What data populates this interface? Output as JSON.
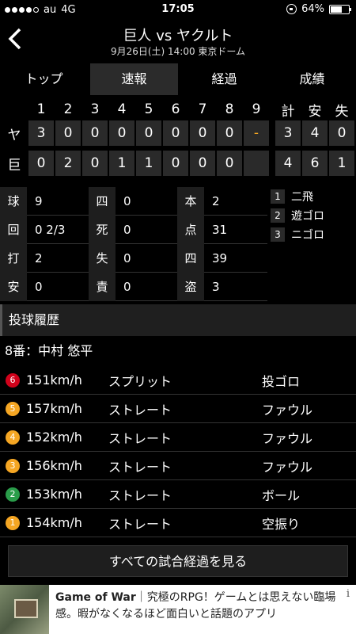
{
  "status": {
    "carrier": "au",
    "network": "4G",
    "time": "17:05",
    "battery": "64%"
  },
  "header": {
    "title": "巨人 vs ヤクルト",
    "subtitle": "9月26日(土) 14:00 東京ドーム"
  },
  "tabs": [
    {
      "label": "トップ"
    },
    {
      "label": "速報"
    },
    {
      "label": "経過"
    },
    {
      "label": "成績"
    }
  ],
  "scoreboard": {
    "columns": [
      "1",
      "2",
      "3",
      "4",
      "5",
      "6",
      "7",
      "8",
      "9",
      "計",
      "安",
      "失"
    ],
    "teams": [
      {
        "name": "ヤ",
        "scores": [
          "3",
          "0",
          "0",
          "0",
          "0",
          "0",
          "0",
          "0",
          "-",
          "3",
          "4",
          "0"
        ]
      },
      {
        "name": "巨",
        "scores": [
          "0",
          "2",
          "0",
          "1",
          "1",
          "0",
          "0",
          "0",
          "",
          "4",
          "6",
          "1"
        ]
      }
    ]
  },
  "stats": [
    {
      "l1": "球",
      "v1": "9",
      "l2": "四",
      "v2": "0",
      "l3": "本",
      "v3": "2"
    },
    {
      "l1": "回",
      "v1": "0 2/3",
      "l2": "死",
      "v2": "0",
      "l3": "点",
      "v3": "31"
    },
    {
      "l1": "打",
      "v1": "2",
      "l2": "失",
      "v2": "0",
      "l3": "四",
      "v3": "39"
    },
    {
      "l1": "安",
      "v1": "0",
      "l2": "責",
      "v2": "0",
      "l3": "盗",
      "v3": "3"
    }
  ],
  "outs": [
    {
      "num": "1",
      "text": "二飛"
    },
    {
      "num": "2",
      "text": "遊ゴロ"
    },
    {
      "num": "3",
      "text": "ニゴロ"
    }
  ],
  "section_title": "投球履歴",
  "pitcher": "8番：中村 悠平",
  "pitches": [
    {
      "n": "6",
      "color": "#d0021b",
      "speed": "151km/h",
      "type": "スプリット",
      "result": "投ゴロ"
    },
    {
      "n": "5",
      "color": "#f5a623",
      "speed": "157km/h",
      "type": "ストレート",
      "result": "ファウル"
    },
    {
      "n": "4",
      "color": "#f5a623",
      "speed": "152km/h",
      "type": "ストレート",
      "result": "ファウル"
    },
    {
      "n": "3",
      "color": "#f5a623",
      "speed": "156km/h",
      "type": "ストレート",
      "result": "ファウル"
    },
    {
      "n": "2",
      "color": "#2a9d4a",
      "speed": "153km/h",
      "type": "ストレート",
      "result": "ボール"
    },
    {
      "n": "1",
      "color": "#f5a623",
      "speed": "154km/h",
      "type": "ストレート",
      "result": "空振り"
    }
  ],
  "all_button": "すべての試合経過を見る",
  "ad": {
    "title": "Game of War",
    "text1": "｜究極のRPG！ゲームとは思えない臨場",
    "text2": "感。暇がなくなるほど面白いと話題のアプリ",
    "info": "i"
  }
}
